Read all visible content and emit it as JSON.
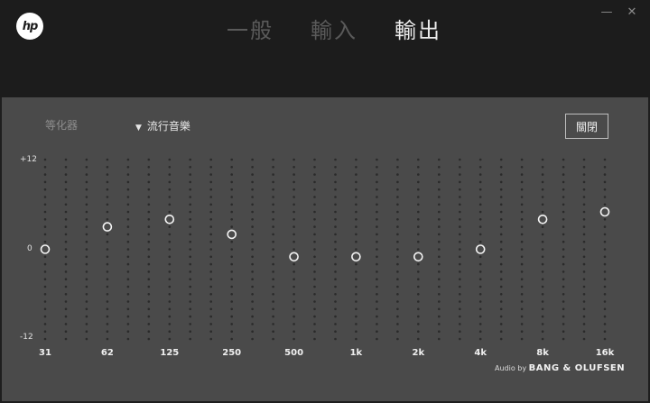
{
  "window": {
    "logo_text": "hp",
    "minimize_glyph": "—",
    "close_glyph": "✕"
  },
  "tabs": [
    {
      "label": "一般",
      "active": false
    },
    {
      "label": "輸入",
      "active": false
    },
    {
      "label": "輸出",
      "active": true
    }
  ],
  "equalizer": {
    "title": "等化器",
    "preset_caret": "▼",
    "preset": "流行音樂",
    "close_label": "關閉",
    "y_max_label": "+12",
    "y_zero_label": "0",
    "y_min_label": "-12",
    "y_range": [
      -12,
      12
    ],
    "bands": [
      {
        "label": "31",
        "gain": 0
      },
      {
        "label": "62",
        "gain": 3
      },
      {
        "label": "125",
        "gain": 4
      },
      {
        "label": "250",
        "gain": 2
      },
      {
        "label": "500",
        "gain": -1
      },
      {
        "label": "1k",
        "gain": -1
      },
      {
        "label": "2k",
        "gain": -1
      },
      {
        "label": "4k",
        "gain": 0
      },
      {
        "label": "8k",
        "gain": 4
      },
      {
        "label": "16k",
        "gain": 5
      }
    ]
  },
  "credit": {
    "prefix": "Audio by",
    "brand": "BANG & OLUFSEN"
  },
  "colors": {
    "header_bg": "#1c1c1c",
    "panel_bg": "#4a4a4a",
    "active_tab": "#ececec",
    "inactive_tab": "#5a5a5a"
  }
}
